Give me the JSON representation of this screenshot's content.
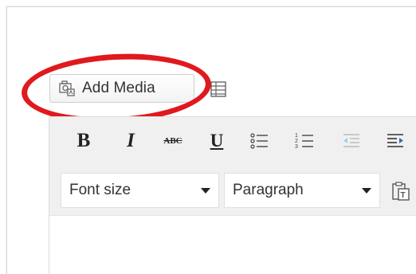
{
  "media_buttons": {
    "add_media_label": "Add Media",
    "add_media_icon": "media-camera-icon",
    "form_icon": "form-icon"
  },
  "toolbar": {
    "bold": "B",
    "italic": "I",
    "strikethrough": "ABC",
    "underline": "U",
    "bullet_list_icon": "bullet-list-icon",
    "numbered_list_icon": "numbered-list-icon",
    "outdent_icon": "outdent-icon",
    "indent_icon": "indent-icon"
  },
  "format_selects": {
    "font_size": "Font size",
    "paragraph": "Paragraph",
    "paste_icon": "paste-text-icon"
  },
  "colors": {
    "highlight": "#e0191e",
    "toolbar_bg": "#f0f0f0"
  }
}
